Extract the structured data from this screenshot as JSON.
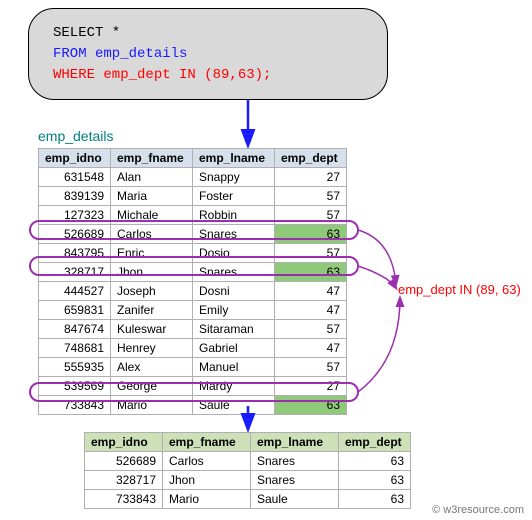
{
  "sql": {
    "select": "SELECT *",
    "from": "FROM emp_details",
    "where": "WHERE emp_dept IN (89,63);"
  },
  "table_name": "emp_details",
  "columns": {
    "idno": "emp_idno",
    "fname": "emp_fname",
    "lname": "emp_lname",
    "dept": "emp_dept"
  },
  "rows": [
    {
      "idno": "631548",
      "fname": "Alan",
      "lname": "Snappy",
      "dept": "27",
      "hl": false
    },
    {
      "idno": "839139",
      "fname": "Maria",
      "lname": "Foster",
      "dept": "57",
      "hl": false
    },
    {
      "idno": "127323",
      "fname": "Michale",
      "lname": "Robbin",
      "dept": "57",
      "hl": false
    },
    {
      "idno": "526689",
      "fname": "Carlos",
      "lname": "Snares",
      "dept": "63",
      "hl": true
    },
    {
      "idno": "843795",
      "fname": "Enric",
      "lname": "Dosio",
      "dept": "57",
      "hl": false
    },
    {
      "idno": "328717",
      "fname": "Jhon",
      "lname": "Snares",
      "dept": "63",
      "hl": true
    },
    {
      "idno": "444527",
      "fname": "Joseph",
      "lname": "Dosni",
      "dept": "47",
      "hl": false
    },
    {
      "idno": "659831",
      "fname": "Zanifer",
      "lname": "Emily",
      "dept": "47",
      "hl": false
    },
    {
      "idno": "847674",
      "fname": "Kuleswar",
      "lname": "Sitaraman",
      "dept": "57",
      "hl": false
    },
    {
      "idno": "748681",
      "fname": "Henrey",
      "lname": "Gabriel",
      "dept": "47",
      "hl": false
    },
    {
      "idno": "555935",
      "fname": "Alex",
      "lname": "Manuel",
      "dept": "57",
      "hl": false
    },
    {
      "idno": "539569",
      "fname": "George",
      "lname": "Mardy",
      "dept": "27",
      "hl": false
    },
    {
      "idno": "733843",
      "fname": "Mario",
      "lname": "Saule",
      "dept": "63",
      "hl": true
    }
  ],
  "result_rows": [
    {
      "idno": "526689",
      "fname": "Carlos",
      "lname": "Snares",
      "dept": "63"
    },
    {
      "idno": "328717",
      "fname": "Jhon",
      "lname": "Snares",
      "dept": "63"
    },
    {
      "idno": "733843",
      "fname": "Mario",
      "lname": "Saule",
      "dept": "63"
    }
  ],
  "filter_label": "emp_dept IN (89, 63)",
  "watermark": "© w3resource.com",
  "chart_data": {
    "type": "table",
    "title": "SQL IN filter on emp_details",
    "sql_query": "SELECT * FROM emp_details WHERE emp_dept IN (89,63);",
    "source_columns": [
      "emp_idno",
      "emp_fname",
      "emp_lname",
      "emp_dept"
    ],
    "source_rows": [
      [
        631548,
        "Alan",
        "Snappy",
        27
      ],
      [
        839139,
        "Maria",
        "Foster",
        57
      ],
      [
        127323,
        "Michale",
        "Robbin",
        57
      ],
      [
        526689,
        "Carlos",
        "Snares",
        63
      ],
      [
        843795,
        "Enric",
        "Dosio",
        57
      ],
      [
        328717,
        "Jhon",
        "Snares",
        63
      ],
      [
        444527,
        "Joseph",
        "Dosni",
        47
      ],
      [
        659831,
        "Zanifer",
        "Emily",
        47
      ],
      [
        847674,
        "Kuleswar",
        "Sitaraman",
        57
      ],
      [
        748681,
        "Henrey",
        "Gabriel",
        47
      ],
      [
        555935,
        "Alex",
        "Manuel",
        57
      ],
      [
        539569,
        "George",
        "Mardy",
        27
      ],
      [
        733843,
        "Mario",
        "Saule",
        63
      ]
    ],
    "result_rows": [
      [
        526689,
        "Carlos",
        "Snares",
        63
      ],
      [
        328717,
        "Jhon",
        "Snares",
        63
      ],
      [
        733843,
        "Mario",
        "Saule",
        63
      ]
    ],
    "highlighted_dept_values": [
      63
    ],
    "filter_values": [
      89,
      63
    ]
  }
}
